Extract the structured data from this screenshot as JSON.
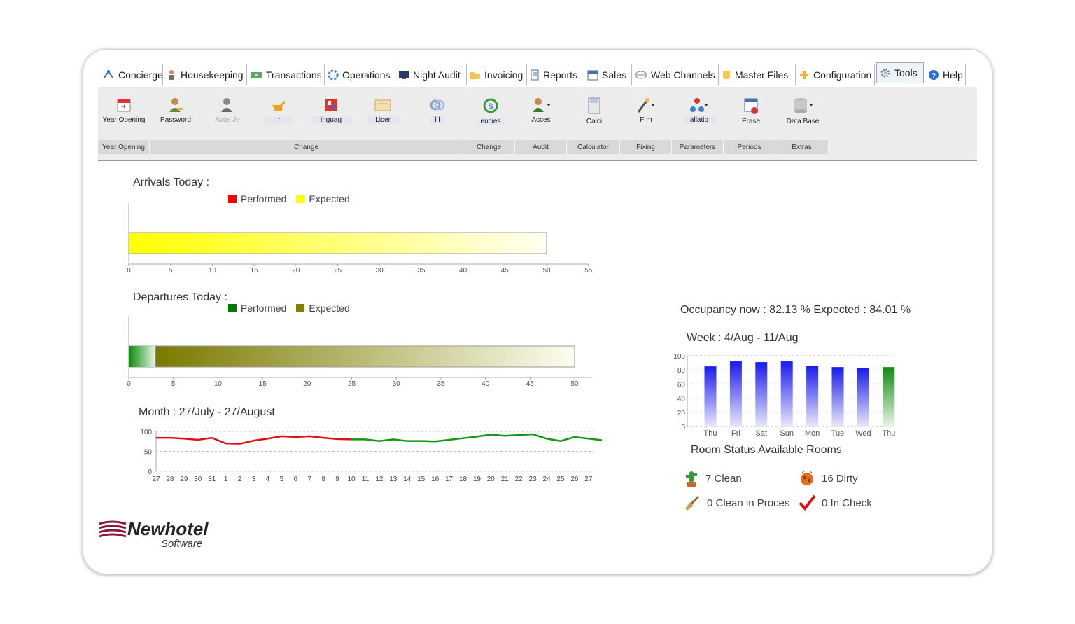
{
  "tabs": [
    {
      "label": "Concierge",
      "icon": "concierge-icon"
    },
    {
      "label": "Housekeeping",
      "icon": "housekeeper-icon"
    },
    {
      "label": "Transactions",
      "icon": "cash-icon"
    },
    {
      "label": "Operations",
      "icon": "operations-icon"
    },
    {
      "label": "Night Audit",
      "icon": "monitor-icon"
    },
    {
      "label": "Invoicing",
      "icon": "folder-icon"
    },
    {
      "label": "Reports",
      "icon": "report-icon"
    },
    {
      "label": "Sales",
      "icon": "calendar-icon"
    },
    {
      "label": "Web Channels",
      "icon": "web-icon"
    },
    {
      "label": "Master Files",
      "icon": "database-icon"
    },
    {
      "label": "Configuration",
      "icon": "puzzle-icon"
    },
    {
      "label": "Tools",
      "icon": "tools-icon",
      "active": true
    },
    {
      "label": "Help",
      "icon": "help-icon"
    }
  ],
  "ribbon": {
    "buttons": [
      {
        "label": "Year Opening",
        "icon": "calendar-open-icon"
      },
      {
        "label": "Password",
        "icon": "user-key-icon"
      },
      {
        "label": "Acce      Je",
        "icon": "user-grey-icon"
      },
      {
        "label": "r",
        "icon": "hand-pointer-icon"
      },
      {
        "label": "inguag",
        "icon": "flag-icon"
      },
      {
        "label": "Licer",
        "icon": "license-icon"
      },
      {
        "label": "l      l",
        "icon": "chain-icon"
      },
      {
        "label": "encies",
        "icon": "currency-icon"
      },
      {
        "label": "Acces",
        "icon": "user-access-icon"
      },
      {
        "label": "Calci",
        "icon": "calculator-icon"
      },
      {
        "label": "F      m",
        "icon": "wand-icon"
      },
      {
        "label": "allatio",
        "icon": "network-icon"
      },
      {
        "label": "Erase",
        "icon": "erase-calendar-icon"
      },
      {
        "label": "Data Base",
        "icon": "database-grey-icon"
      }
    ],
    "groups": [
      "Year Opening",
      "Change",
      "Change",
      "Audit",
      "Calculator",
      "Fixing",
      "Parameters",
      "Periods",
      "Extras"
    ]
  },
  "arrivals": {
    "title": "Arrivals Today :",
    "legend": [
      {
        "label": "Performed",
        "color": "#ff0000"
      },
      {
        "label": "Expected",
        "color": "#ffff00"
      }
    ],
    "performed": 0,
    "expected": 50,
    "axis_ticks": [
      "0",
      "5",
      "10",
      "15",
      "20",
      "25",
      "30",
      "35",
      "40",
      "45",
      "50",
      "55"
    ],
    "axis_max": 55
  },
  "departures": {
    "title": "Departures Today :",
    "legend": [
      {
        "label": "Performed",
        "color": "#007a00"
      },
      {
        "label": "Expected",
        "color": "#808000"
      }
    ],
    "performed": 3,
    "expected": 47,
    "axis_ticks": [
      "0",
      "5",
      "10",
      "15",
      "20",
      "25",
      "30",
      "35",
      "40",
      "45",
      "50"
    ],
    "axis_max": 52
  },
  "month": {
    "title": "Month : 27/July - 27/August",
    "y_ticks": [
      "100",
      "50",
      "0"
    ],
    "x_labels": [
      "27",
      "28",
      "29",
      "30",
      "31",
      "1",
      "2",
      "3",
      "4",
      "5",
      "6",
      "7",
      "8",
      "9",
      "10",
      "11",
      "12",
      "13",
      "14",
      "15",
      "16",
      "17",
      "18",
      "19",
      "20",
      "21",
      "22",
      "23",
      "24",
      "25",
      "26",
      "27"
    ]
  },
  "occupancy": {
    "text": "Occupancy now : 82.13 % Expected : 84.01 %",
    "week_title": "Week : 4/Aug - 11/Aug"
  },
  "chart_data": [
    {
      "type": "line",
      "title": "Month : 27/July - 27/August",
      "x": [
        "27",
        "28",
        "29",
        "30",
        "31",
        "1",
        "2",
        "3",
        "4",
        "5",
        "6",
        "7",
        "8",
        "9",
        "10",
        "11",
        "12",
        "13",
        "14",
        "15",
        "16",
        "17",
        "18",
        "19",
        "20",
        "21",
        "22",
        "23",
        "24",
        "25",
        "26",
        "27"
      ],
      "ylim": [
        0,
        100
      ],
      "series": [
        {
          "values": [
            84,
            84,
            82,
            79,
            84,
            70,
            69,
            77,
            82,
            88,
            86,
            88,
            84,
            81,
            80
          ],
          "color": "#e01010"
        },
        {
          "values": [
            80,
            80,
            76,
            80,
            76,
            76,
            75,
            79,
            83,
            87,
            92,
            89,
            91,
            93,
            82,
            76,
            86,
            82,
            78
          ],
          "x_start_index": 14,
          "color": "#119911"
        }
      ]
    },
    {
      "type": "bar",
      "title": "Week : 4/Aug - 11/Aug",
      "categories": [
        "Thu",
        "Fri",
        "Sat",
        "Sun",
        "Mon",
        "Tue",
        "Wed",
        "Thu"
      ],
      "values": [
        85,
        92,
        91,
        92,
        86,
        84,
        83,
        84
      ],
      "colors": [
        "#1a1aee",
        "#1a1aee",
        "#1a1aee",
        "#1a1aee",
        "#1a1aee",
        "#1a1aee",
        "#1a1aee",
        "#118a11"
      ],
      "ylim": [
        0,
        100
      ],
      "y_ticks": [
        "100",
        "80",
        "60",
        "40",
        "20",
        "0"
      ]
    },
    {
      "type": "bar",
      "title": "Arrivals Today :",
      "orientation": "horizontal",
      "series": [
        {
          "name": "Performed",
          "values": [
            0
          ]
        },
        {
          "name": "Expected",
          "values": [
            50
          ]
        }
      ],
      "xlim": [
        0,
        55
      ]
    },
    {
      "type": "bar",
      "title": "Departures Today :",
      "orientation": "horizontal",
      "series": [
        {
          "name": "Performed",
          "values": [
            3
          ]
        },
        {
          "name": "Expected",
          "values": [
            47
          ]
        }
      ],
      "xlim": [
        0,
        52
      ]
    }
  ],
  "room_status": {
    "title": "Room Status Available Rooms",
    "items": [
      {
        "label": "7 Clean",
        "icon": "cactus-icon"
      },
      {
        "label": "16 Dirty",
        "icon": "dirty-icon"
      },
      {
        "label": "0 Clean in Proces",
        "icon": "broom-icon"
      },
      {
        "label": "0 In Check",
        "icon": "checkmark-icon"
      }
    ]
  },
  "logo": {
    "name": "Newhotel",
    "sub": "Software"
  }
}
